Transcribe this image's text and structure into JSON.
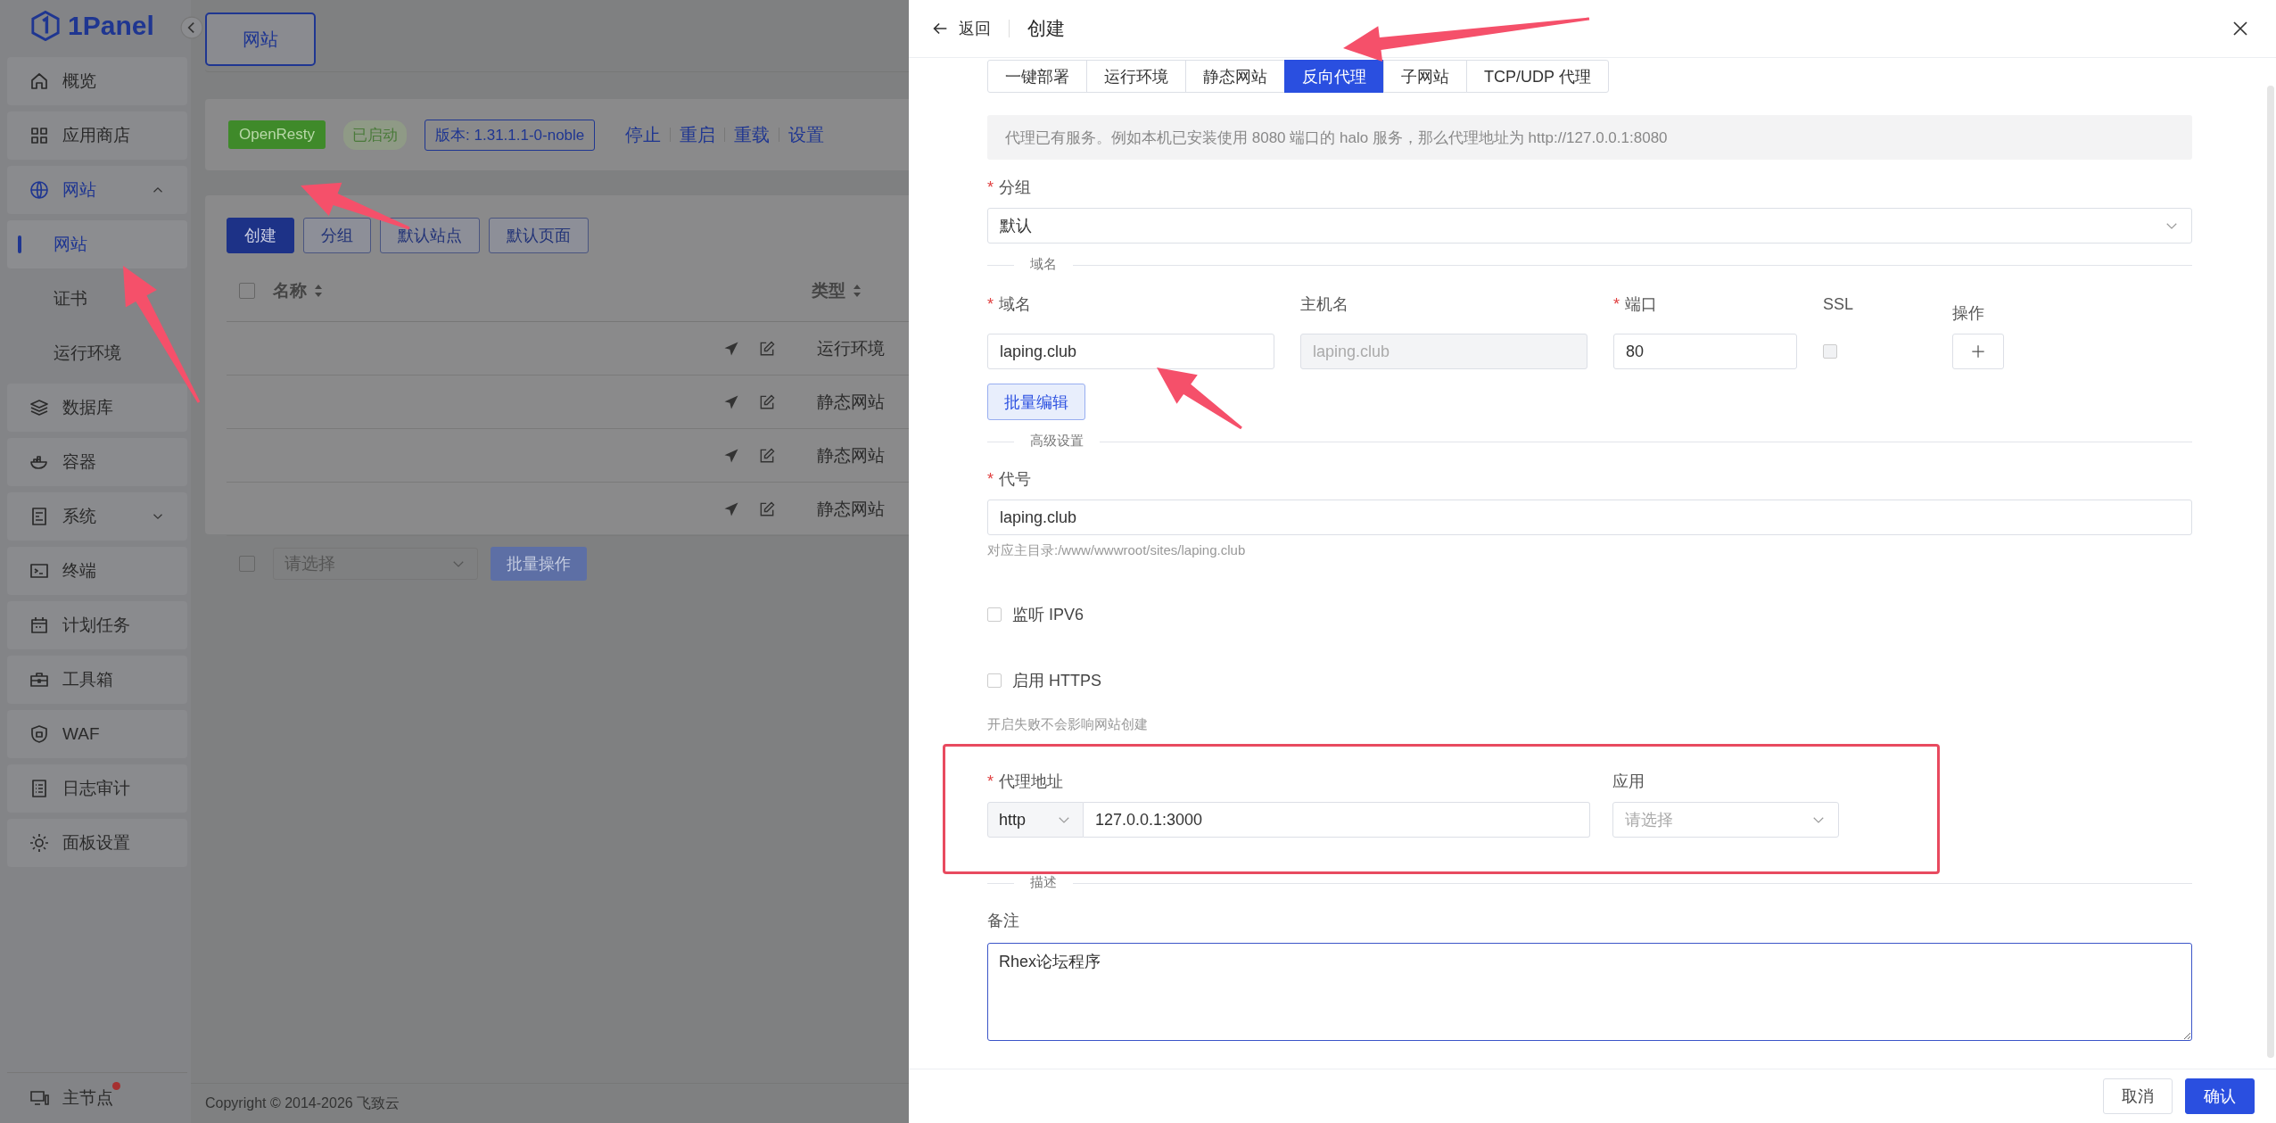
{
  "sidebar": {
    "logo": "1Panel",
    "items": [
      {
        "label": "概览",
        "selected": false
      },
      {
        "label": "应用商店",
        "selected": false
      },
      {
        "label": "网站",
        "selected": true,
        "expanded": true,
        "children": [
          {
            "label": "网站",
            "selected": true
          },
          {
            "label": "证书",
            "selected": false
          },
          {
            "label": "运行环境",
            "selected": false
          }
        ]
      },
      {
        "label": "数据库",
        "selected": false
      },
      {
        "label": "容器",
        "selected": false
      },
      {
        "label": "系统",
        "selected": false,
        "expanded": false
      },
      {
        "label": "终端",
        "selected": false
      },
      {
        "label": "计划任务",
        "selected": false
      },
      {
        "label": "工具箱",
        "selected": false
      },
      {
        "label": "WAF",
        "selected": false
      },
      {
        "label": "日志审计",
        "selected": false
      },
      {
        "label": "面板设置",
        "selected": false
      }
    ],
    "node": "主节点",
    "node_alert": true
  },
  "page_tab": "网站",
  "server_bar": {
    "app": "OpenResty",
    "status": "已启动",
    "version": "版本: 1.31.1.1-0-noble",
    "actions": [
      "停止",
      "重启",
      "重载",
      "设置"
    ]
  },
  "toolbar": [
    {
      "label": "创建",
      "kind": "primary"
    },
    {
      "label": "分组",
      "kind": "default"
    },
    {
      "label": "默认站点",
      "kind": "default"
    },
    {
      "label": "默认页面",
      "kind": "default"
    }
  ],
  "table": {
    "header_checked": false,
    "columns": [
      "名称",
      "类型"
    ],
    "rows": [
      {
        "type": "运行环境"
      },
      {
        "type": "静态网站"
      },
      {
        "type": "静态网站"
      },
      {
        "type": "静态网站"
      }
    ]
  },
  "batch": {
    "checked": false,
    "placeholder": "请选择",
    "button": "批量操作"
  },
  "copyright": "Copyright © 2014-2026 飞致云",
  "drawer": {
    "back": "返回",
    "title": "创建",
    "tabs": [
      {
        "label": "一键部署",
        "selected": false
      },
      {
        "label": "运行环境",
        "selected": false
      },
      {
        "label": "静态网站",
        "selected": false
      },
      {
        "label": "反向代理",
        "selected": true
      },
      {
        "label": "子网站",
        "selected": false
      },
      {
        "label": "TCP/UDP 代理",
        "selected": false
      }
    ],
    "notice": "代理已有服务。例如本机已安装使用 8080 端口的 halo 服务，那么代理地址为 http://127.0.0.1:8080",
    "required_mark": "*",
    "group": {
      "label": "分组",
      "required": true,
      "value": "默认"
    },
    "domain_divider": "域名",
    "domain_columns": [
      {
        "label": "域名",
        "required": true
      },
      {
        "label": "主机名",
        "required": false
      },
      {
        "label": "端口",
        "required": true
      },
      {
        "label": "SSL",
        "required": false
      },
      {
        "label": "操作",
        "required": false
      }
    ],
    "domain_row": {
      "domain": "laping.club",
      "host": "laping.club",
      "host_disabled": true,
      "port": "80",
      "ssl_checked": false
    },
    "batch_edit": "批量编辑",
    "advanced_divider": "高级设置",
    "alias": {
      "label": "代号",
      "required": true,
      "value": "laping.club",
      "hint": "对应主目录:/www/wwwroot/sites/laping.club"
    },
    "options": [
      {
        "label": "监听 IPV6",
        "checked": false
      },
      {
        "label": "启用 HTTPS",
        "checked": false,
        "hint": "开启失败不会影响网站创建"
      }
    ],
    "proxy": {
      "label": "代理地址",
      "required": true,
      "protocol": "http",
      "address": "127.0.0.1:3000",
      "app_label": "应用",
      "app_placeholder": "请选择"
    },
    "desc_divider": "描述",
    "remark": {
      "label": "备注",
      "value": "Rhex论坛程序"
    },
    "buttons": [
      {
        "label": "取消",
        "kind": "default"
      },
      {
        "label": "确认",
        "kind": "primary"
      }
    ]
  }
}
